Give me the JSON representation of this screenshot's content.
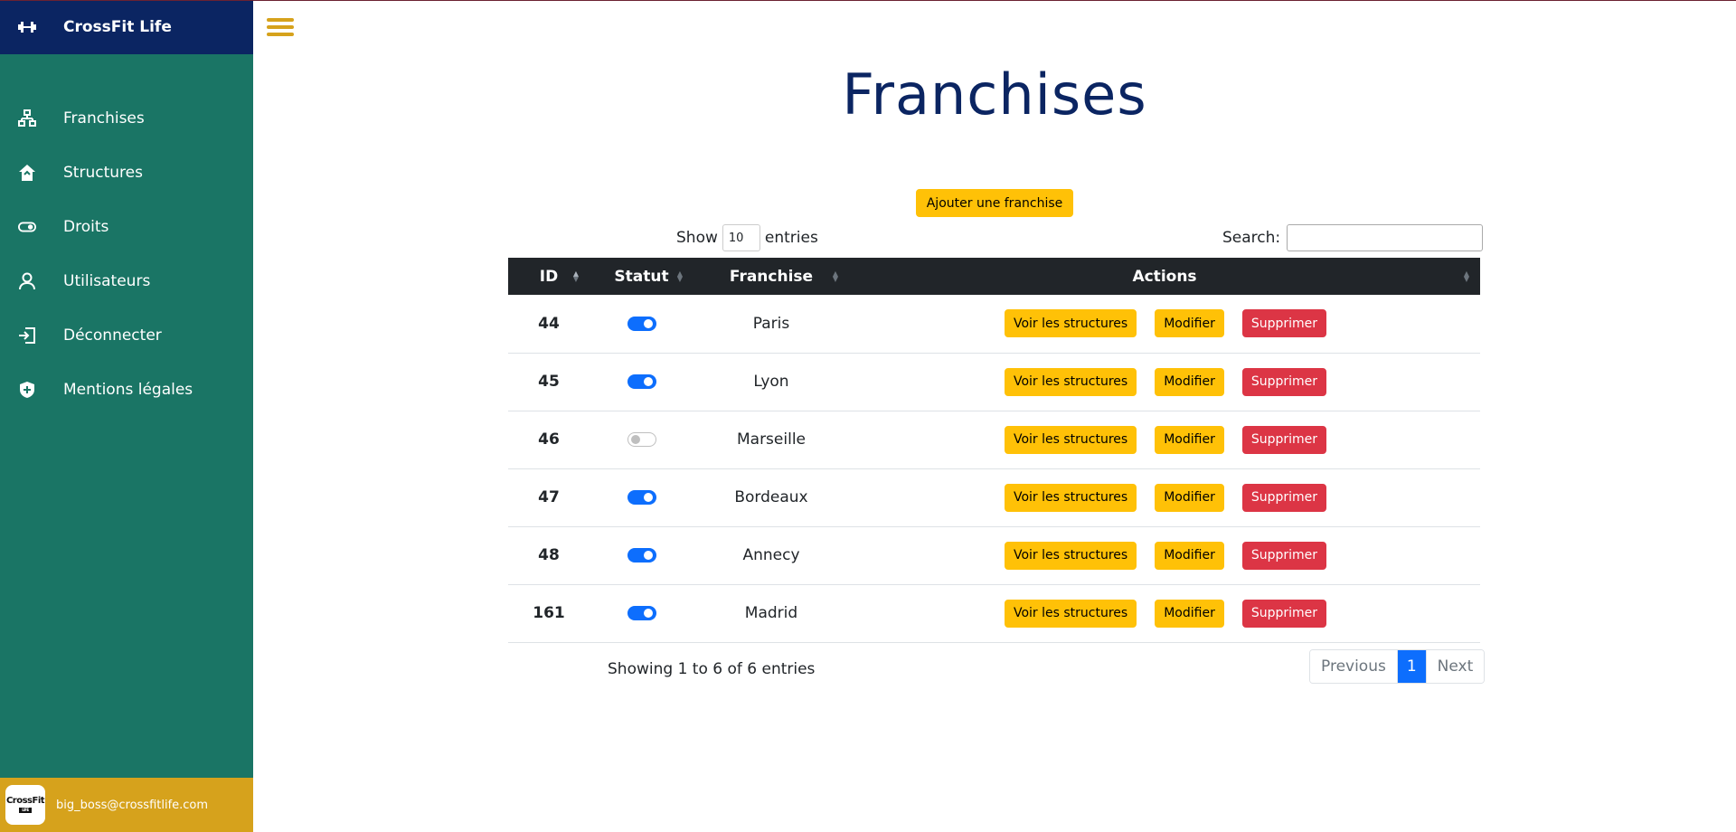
{
  "brand": {
    "name": "CrossFit Life"
  },
  "sidebar": {
    "items": [
      {
        "label": "Franchises",
        "icon": "sitemap-icon"
      },
      {
        "label": "Structures",
        "icon": "home-icon"
      },
      {
        "label": "Droits",
        "icon": "toggle-icon"
      },
      {
        "label": "Utilisateurs",
        "icon": "user-icon"
      },
      {
        "label": "Déconnecter",
        "icon": "logout-icon"
      },
      {
        "label": "Mentions légales",
        "icon": "shield-plus-icon"
      }
    ],
    "user": {
      "email": "big_boss@crossfitlife.com",
      "avatar_text": "CrossFit",
      "avatar_sub": "LIFE"
    }
  },
  "page": {
    "title": "Franchises",
    "add_button": "Ajouter une franchise"
  },
  "table_controls": {
    "show_label": "Show",
    "show_value": "10",
    "entries_label": "entries",
    "search_label": "Search:"
  },
  "table": {
    "headers": {
      "id": "ID",
      "status": "Statut",
      "franchise": "Franchise",
      "actions": "Actions"
    },
    "rows": [
      {
        "id": "44",
        "active": true,
        "name": "Paris"
      },
      {
        "id": "45",
        "active": true,
        "name": "Lyon"
      },
      {
        "id": "46",
        "active": false,
        "name": "Marseille"
      },
      {
        "id": "47",
        "active": true,
        "name": "Bordeaux"
      },
      {
        "id": "48",
        "active": true,
        "name": "Annecy"
      },
      {
        "id": "161",
        "active": true,
        "name": "Madrid"
      }
    ],
    "action_labels": {
      "view": "Voir les structures",
      "edit": "Modifier",
      "delete": "Supprimer"
    }
  },
  "footer": {
    "info": "Showing 1 to 6 of 6 entries",
    "previous": "Previous",
    "page": "1",
    "next": "Next"
  },
  "colors": {
    "sidebar": "#1a7565",
    "brand_bar": "#0b2562",
    "user_bar": "#d6a21c",
    "warning": "#ffc107",
    "danger": "#dc3545",
    "primary": "#0d6efd"
  }
}
